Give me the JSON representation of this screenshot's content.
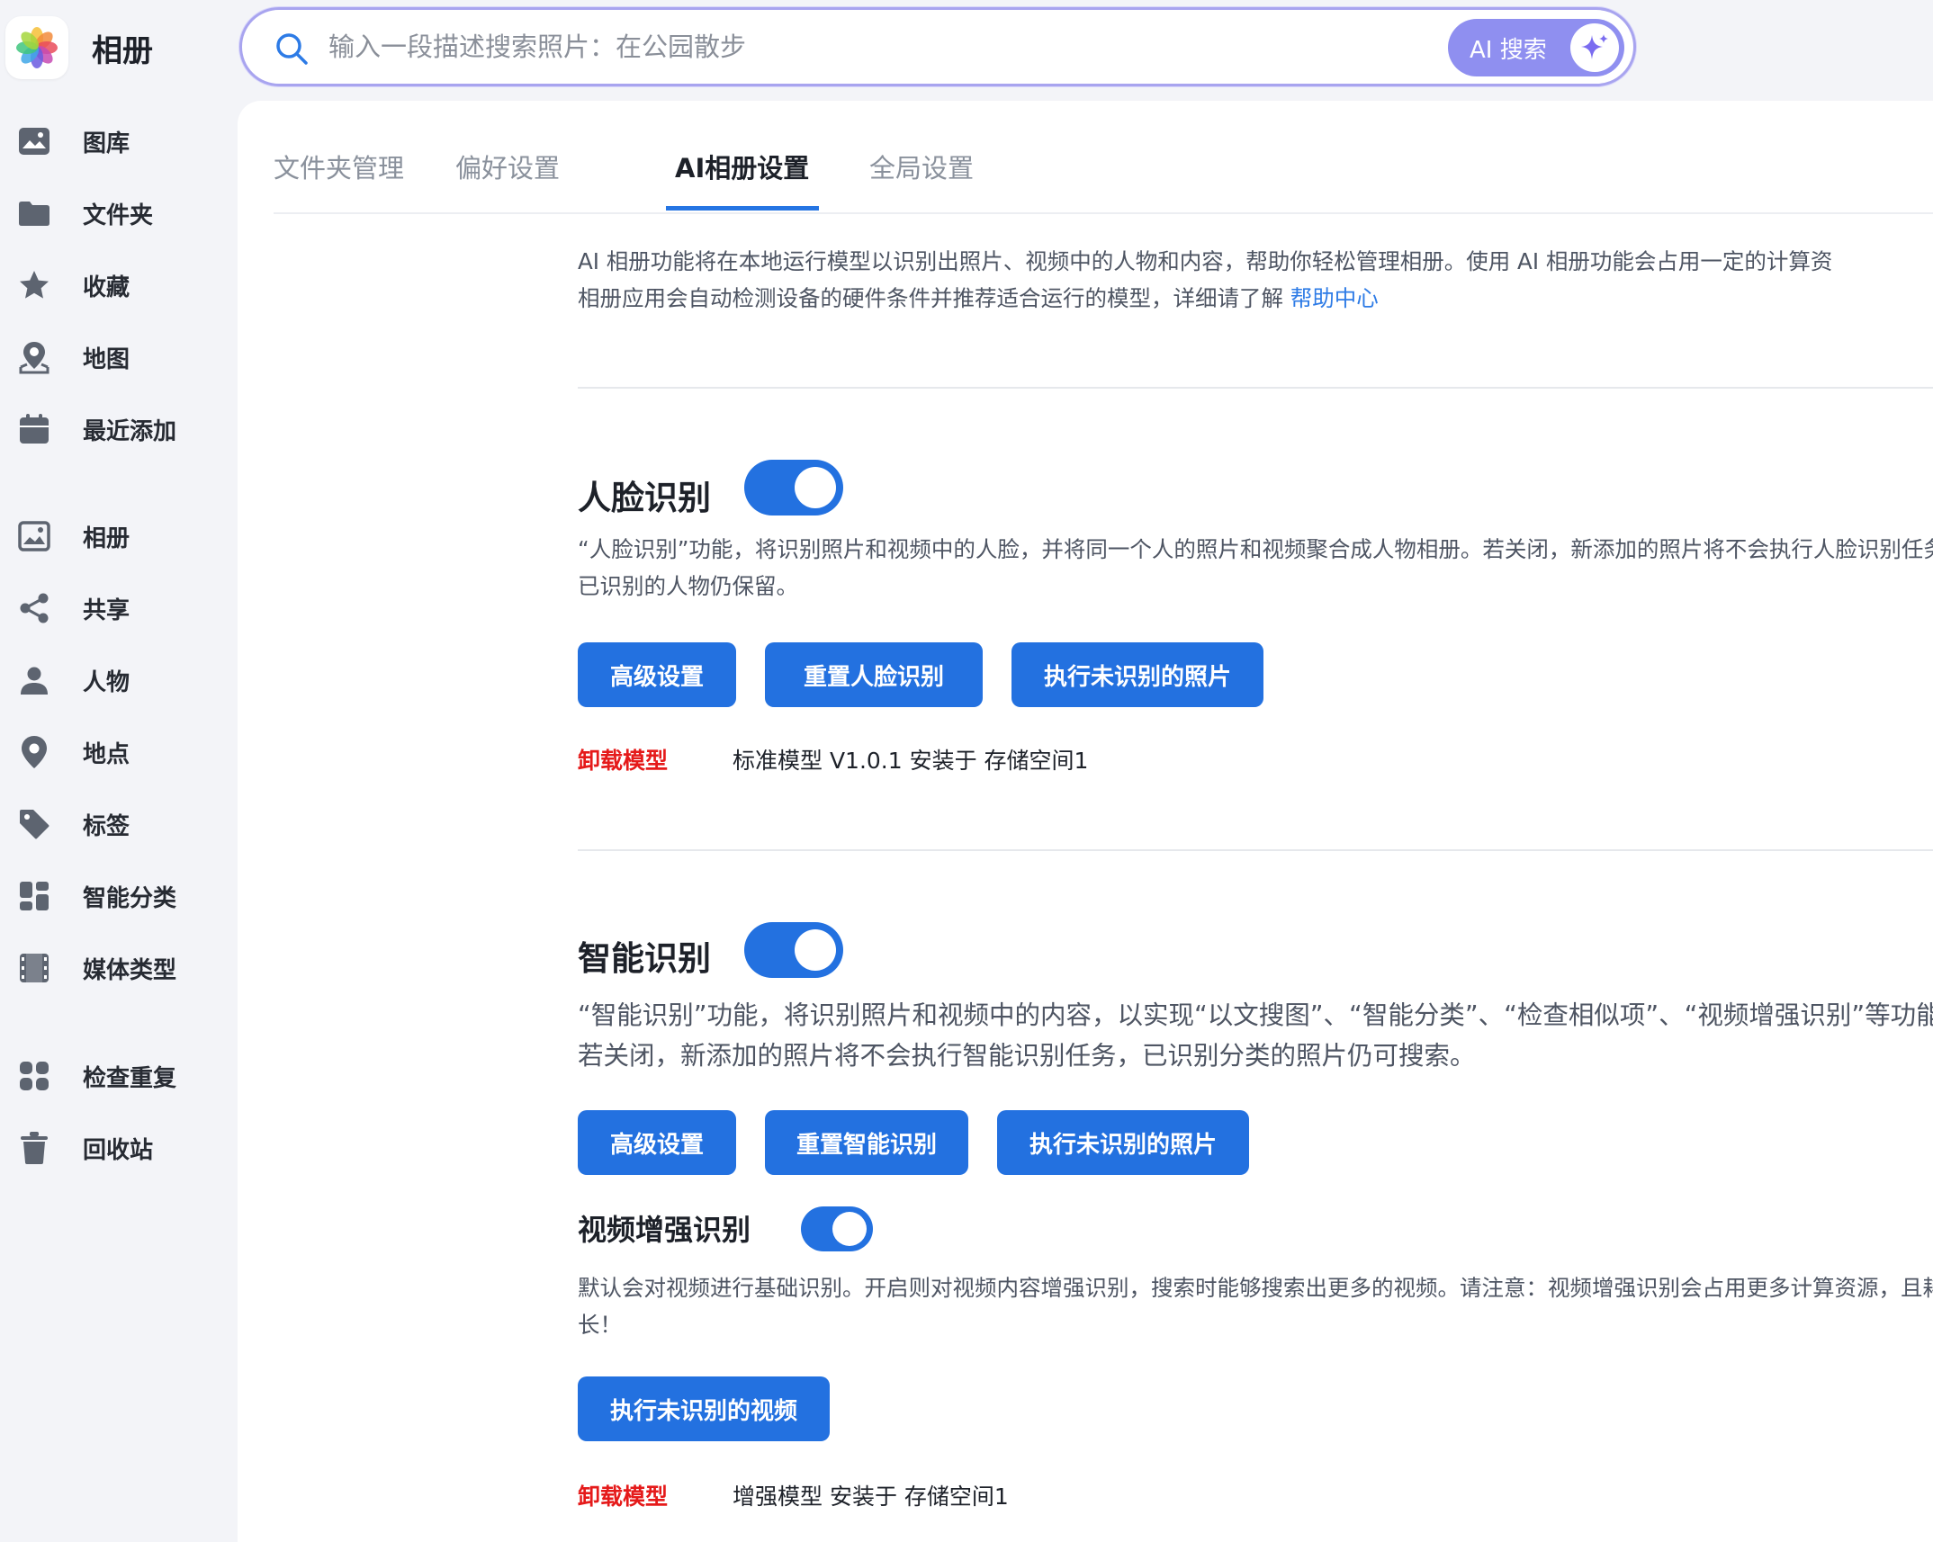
{
  "app": {
    "title": "相册"
  },
  "sidebar": {
    "items": [
      {
        "label": "图库",
        "icon": "gallery-icon"
      },
      {
        "label": "文件夹",
        "icon": "folder-icon"
      },
      {
        "label": "收藏",
        "icon": "star-icon"
      },
      {
        "label": "地图",
        "icon": "map-icon"
      },
      {
        "label": "最近添加",
        "icon": "calendar-icon"
      },
      {
        "label": "相册",
        "icon": "album-icon"
      },
      {
        "label": "共享",
        "icon": "share-icon"
      },
      {
        "label": "人物",
        "icon": "person-icon"
      },
      {
        "label": "地点",
        "icon": "location-pin-icon"
      },
      {
        "label": "标签",
        "icon": "tag-icon"
      },
      {
        "label": "智能分类",
        "icon": "grid-icon"
      },
      {
        "label": "媒体类型",
        "icon": "film-icon"
      },
      {
        "label": "检查重复",
        "icon": "duplicate-icon"
      },
      {
        "label": "回收站",
        "icon": "trash-icon"
      }
    ]
  },
  "search": {
    "placeholder": "输入一段描述搜索照片：在公园散步",
    "ai_button_label": "AI 搜索"
  },
  "tabs": [
    {
      "label": "文件夹管理",
      "active": false
    },
    {
      "label": "偏好设置",
      "active": false
    },
    {
      "label": "AI相册设置",
      "active": true
    },
    {
      "label": "全局设置",
      "active": false
    }
  ],
  "intro": {
    "line1": "AI 相册功能将在本地运行模型以识别出照片、视频中的人物和内容，帮助你轻松管理相册。使用 AI 相册功能会占用一定的计算资",
    "line2": "相册应用会自动检测设备的硬件条件并推荐适合运行的模型，详细请了解 ",
    "help_link": "帮助中心"
  },
  "face": {
    "title": "人脸识别",
    "enabled": true,
    "description": "“人脸识别”功能，将识别照片和视频中的人脸，并将同一个人的照片和视频聚合成人物相册。若关闭，新添加的照片将不会执行人脸识别任务，已识别的人物仍保留。",
    "buttons": [
      "高级设置",
      "重置人脸识别",
      "执行未识别的照片"
    ],
    "unload_label": "卸载模型",
    "model_info": "标准模型 V1.0.1 安装于 存储空间1"
  },
  "smart": {
    "title": "智能识别",
    "enabled": true,
    "description": "“智能识别”功能，将识别照片和视频中的内容，以实现“以文搜图”、“智能分类”、“检查相似项”、“视频增强识别”等功能。若关闭，新添加的照片将不会执行智能识别任务，已识别分类的照片仍可搜索。",
    "buttons": [
      "高级设置",
      "重置智能识别",
      "执行未识别的照片"
    ]
  },
  "video": {
    "title": "视频增强识别",
    "enabled": true,
    "description": "默认会对视频进行基础识别。开启则对视频内容增强识别，搜索时能够搜索出更多的视频。请注意：视频增强识别会占用更多计算资源，且耗时长！",
    "button": "执行未识别的视频",
    "unload_label": "卸载模型",
    "model_info": "增强模型 安装于 存储空间1"
  },
  "colors": {
    "accent": "#2371e0",
    "danger": "#e51a1a",
    "link": "#2d7be6",
    "search_border": "#a8a4ef",
    "ai_button": "#8f8ff0"
  }
}
